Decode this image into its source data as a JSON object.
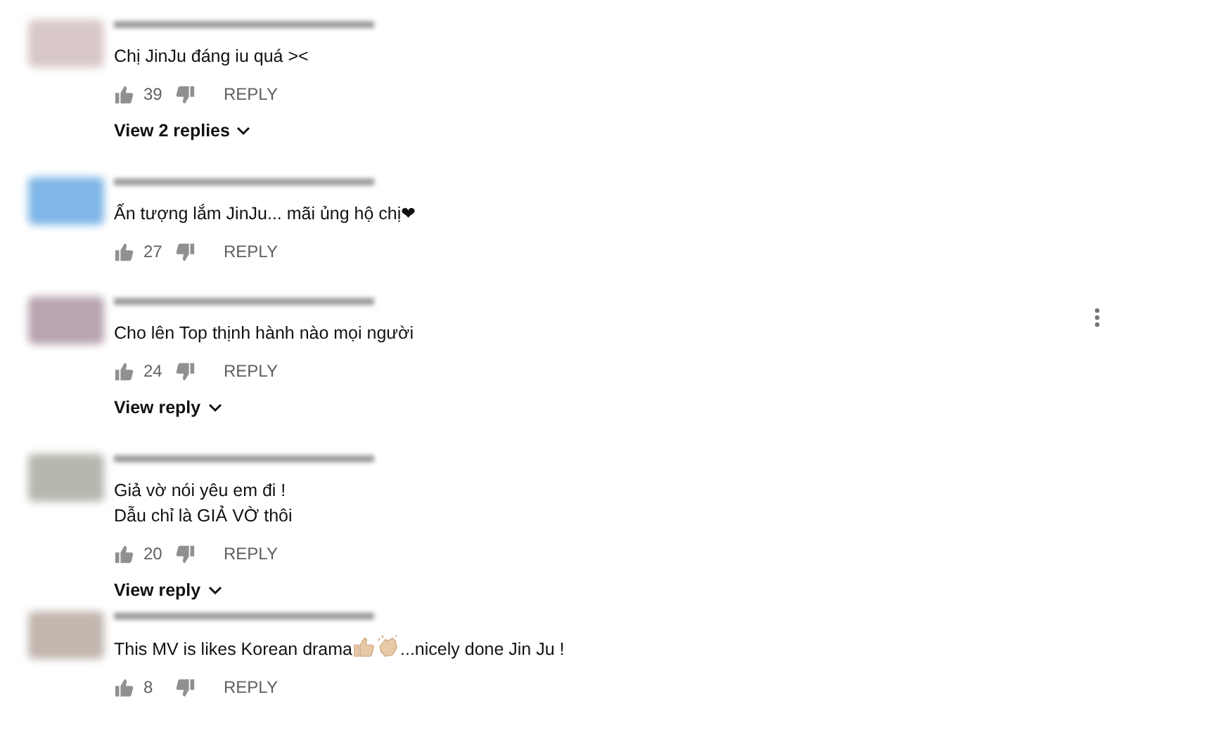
{
  "comments": [
    {
      "color": "#d9c8c8",
      "parts": [
        {
          "kind": "text",
          "text": "Chị JinJu đáng iu quá ><"
        }
      ],
      "likes": "39",
      "reply": "REPLY",
      "replies": "View 2 replies",
      "menu_visible": false
    },
    {
      "color": "#7fb7e8",
      "parts": [
        {
          "kind": "text",
          "text": "Ấn tượng lắm JinJu... mãi ủng hộ chị❤"
        }
      ],
      "likes": "27",
      "reply": "REPLY",
      "menu_visible": false
    },
    {
      "color": "#b9a4b0",
      "parts": [
        {
          "kind": "text",
          "text": "Cho lên Top thịnh hành nào mọi người"
        }
      ],
      "likes": "24",
      "reply": "REPLY",
      "replies": "View reply",
      "menu_visible": true
    },
    {
      "color": "#b4b8ae",
      "parts": [
        {
          "kind": "text",
          "text": "Giả vờ nói yêu em đi !"
        },
        {
          "kind": "break"
        },
        {
          "kind": "text",
          "text": "Dẫu chỉ là GIẢ VỜ thôi"
        }
      ],
      "likes": "20",
      "reply": "REPLY",
      "replies": "View reply",
      "menu_visible": false
    },
    {
      "color": "#c2b6ae",
      "parts": [
        {
          "kind": "text",
          "text": "This MV is likes Korean drama"
        },
        {
          "kind": "thumbs-up-emoji"
        },
        {
          "kind": "clap-emoji"
        },
        {
          "kind": "text",
          "text": "...nicely done Jin Ju !"
        }
      ],
      "likes": "8",
      "reply": "REPLY",
      "menu_visible": false
    }
  ]
}
